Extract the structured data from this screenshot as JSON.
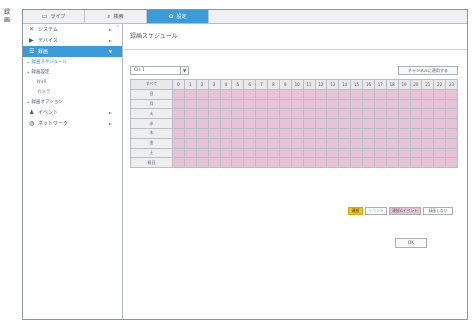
{
  "side_note": "録\n画",
  "topbar": {
    "tabs": [
      {
        "label": "ライブ",
        "icon": "monitor-icon",
        "glyph": "▭",
        "active": false
      },
      {
        "label": "検索",
        "icon": "search-icon",
        "glyph": "⌕",
        "active": false
      },
      {
        "label": "設定",
        "icon": "gear-icon",
        "glyph": "✿",
        "active": true
      }
    ]
  },
  "sidebar": {
    "collapse_glyph": "⌃",
    "items": [
      {
        "label": "システム",
        "icon": "tools-icon",
        "glyph": "✕",
        "arrow": "►",
        "active": false
      },
      {
        "label": "デバイス",
        "icon": "camera-icon",
        "glyph": "▶",
        "arrow": "►",
        "active": false
      },
      {
        "label": "録画",
        "icon": "record-icon",
        "glyph": "☰",
        "arrow": "▼",
        "active": true
      }
    ],
    "record_subs": [
      {
        "label": "録画スケジュール",
        "selected": true
      },
      {
        "label": "録画設定",
        "selected": false
      },
      {
        "label": "NVR",
        "indent": true
      },
      {
        "label": "カメラ",
        "indent": true
      },
      {
        "label": "録画オプション",
        "selected": false
      }
    ],
    "bottom_items": [
      {
        "label": "イベント",
        "icon": "bell-icon",
        "glyph": "♟",
        "arrow": "►"
      },
      {
        "label": "ネットワーク",
        "icon": "network-icon",
        "glyph": "◍",
        "arrow": "►"
      }
    ]
  },
  "main": {
    "title": "録画スケジュール",
    "channel": "CH 1",
    "dropdown_glyph": "▼",
    "apply_all_label": "チャンネルに適用する",
    "grid": {
      "corner": "すべて",
      "hours": [
        "0",
        "1",
        "2",
        "3",
        "4",
        "5",
        "6",
        "7",
        "8",
        "9",
        "10",
        "11",
        "12",
        "13",
        "14",
        "15",
        "16",
        "17",
        "18",
        "19",
        "20",
        "21",
        "22",
        "23"
      ],
      "days": [
        "日",
        "月",
        "火",
        "水",
        "木",
        "金",
        "土",
        "祝日"
      ]
    },
    "legend": {
      "continuous": "連続",
      "event": "イベント",
      "both": "連続&イベント",
      "none": "録画しない"
    },
    "ok_label": "OK"
  },
  "colors": {
    "accent": "#3a9bd8",
    "schedule_both": "#e7c3d7",
    "continuous": "#f1c218",
    "event_text": "#5ab3e6"
  }
}
